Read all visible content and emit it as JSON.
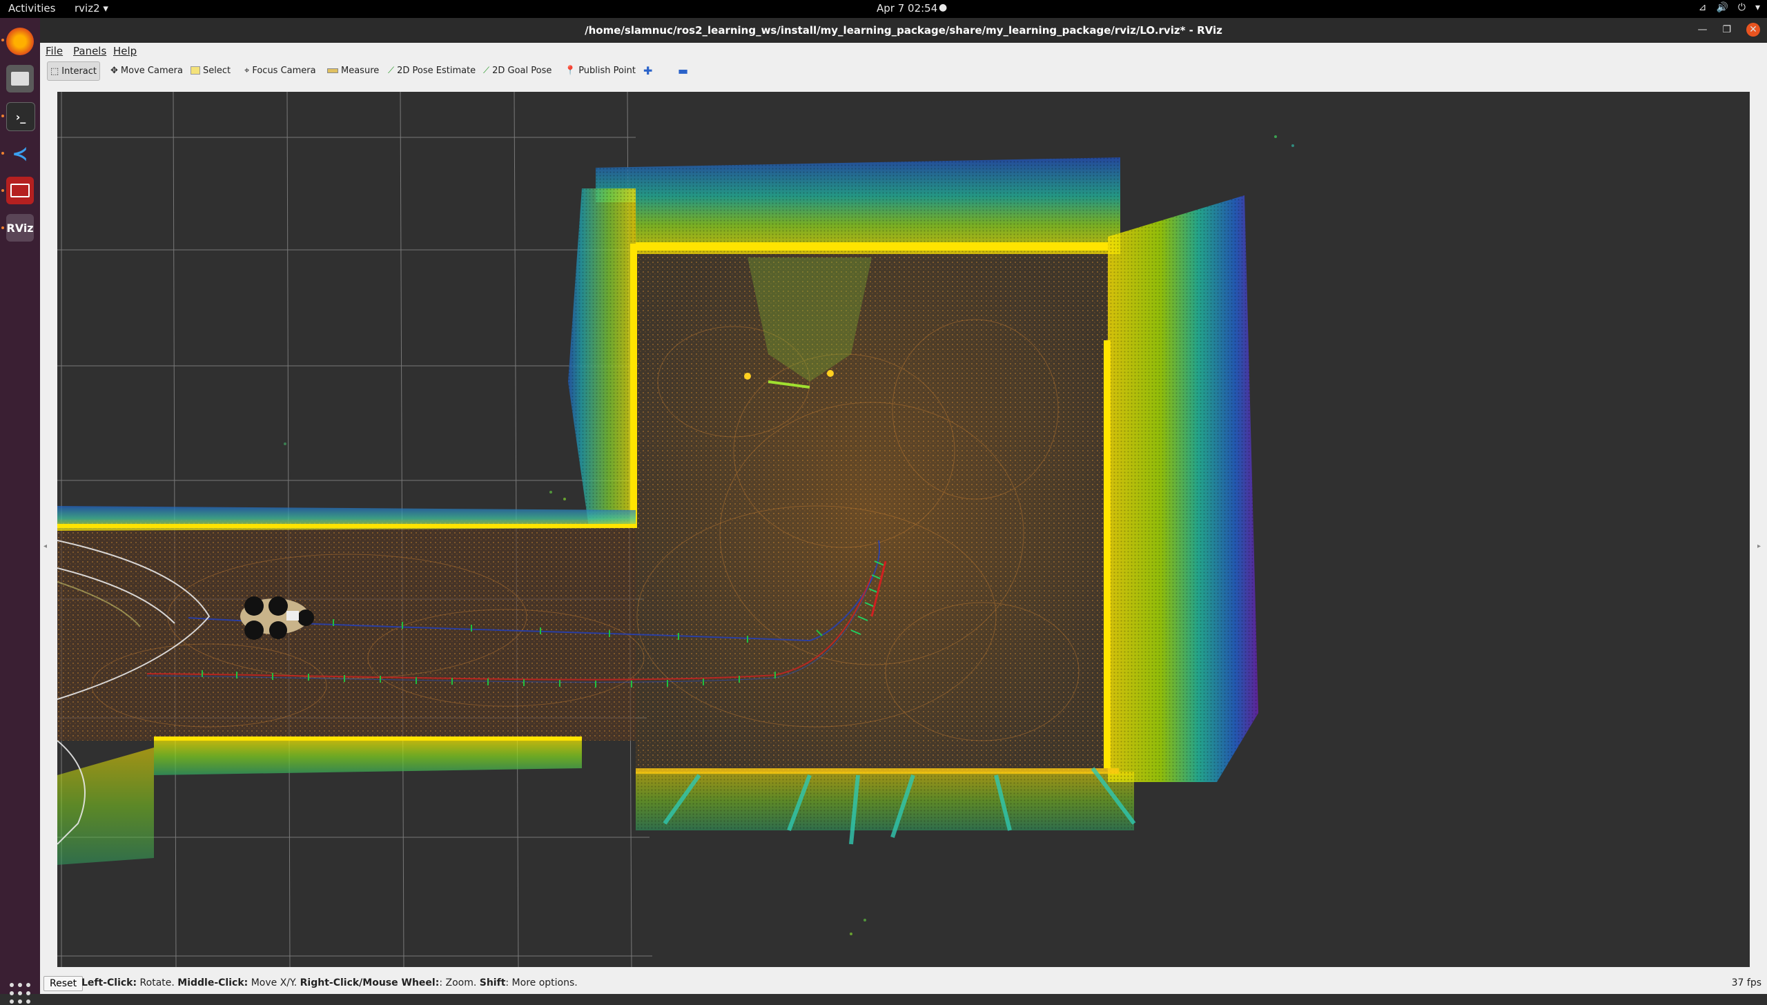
{
  "topbar": {
    "activities": "Activities",
    "app_menu": "rviz2 ▾",
    "clock": "Apr 7  02:54",
    "indicator": "●"
  },
  "window": {
    "title": "/home/slamnuc/ros2_learning_ws/install/my_learning_package/share/my_learning_package/rviz/LO.rviz* - RViz"
  },
  "menubar": {
    "file": "File",
    "panels": "Panels",
    "help": "Help"
  },
  "toolbar": {
    "interact": "Interact",
    "move_camera": "Move Camera",
    "select": "Select",
    "focus_camera": "Focus Camera",
    "measure": "Measure",
    "pose_estimate": "2D Pose Estimate",
    "goal_pose": "2D Goal Pose",
    "publish_point": "Publish Point"
  },
  "statusbar": {
    "reset": "Reset",
    "hint_parts": [
      {
        "label": "Left-Click:",
        "text": " Rotate. "
      },
      {
        "label": "Middle-Click:",
        "text": " Move X/Y. "
      },
      {
        "label": "Right-Click/Mouse Wheel:",
        "text": ": Zoom. "
      },
      {
        "label": "Shift",
        "text": ": More options."
      }
    ],
    "fps": "37 fps"
  },
  "dock": {
    "apps": [
      "firefox-icon",
      "files-icon",
      "terminal-icon",
      "vscode-icon",
      "media-icon",
      "rviz-icon"
    ],
    "rviz_label": "RViz"
  },
  "colors": {
    "viewport_bg": "#303030",
    "grid": "#a0a0a0",
    "accent": "#e95420",
    "dock_bg": "#3a1f33"
  }
}
